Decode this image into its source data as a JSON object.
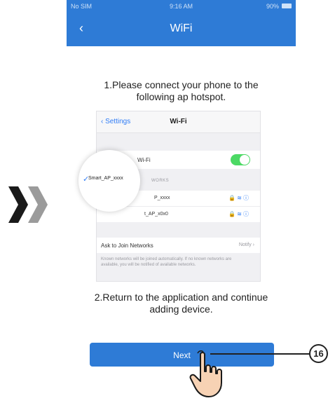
{
  "status_bar": {
    "carrier": "No SIM",
    "time": "9:16 AM",
    "battery": "90%"
  },
  "nav": {
    "back_icon": "‹",
    "title": "WiFi"
  },
  "instructions": {
    "step1_line1": "1.Please connect your phone to the",
    "step1_line2": "following ap hotspot.",
    "step2_line1": "2.Return to the application and continue",
    "step2_line2": "adding device."
  },
  "ios_screen": {
    "back_label": "Settings",
    "title": "Wi-Fi",
    "wifi_label": "Wi-Fi",
    "wifi_on": true,
    "networks_header": "WORKS",
    "networks": [
      {
        "name": "P_xxxx"
      },
      {
        "name": "t_AP_x0x0"
      }
    ],
    "ask_label": "Ask to Join Networks",
    "ask_value": "Notify",
    "ask_note": "Known networks will be joined automatically. If no known networks are available, you will be notified of available networks."
  },
  "magnifier": {
    "selected_network": "Smart_AP_xxxx"
  },
  "next_button": {
    "label": "Next"
  },
  "callout": {
    "number": "16"
  },
  "colors": {
    "accent": "#2e7bd6",
    "toggle_on": "#4cd964",
    "ios_link": "#2f7cf6"
  }
}
